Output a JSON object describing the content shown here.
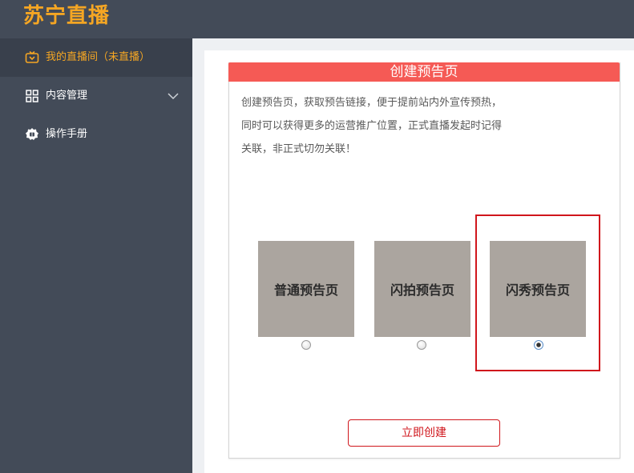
{
  "app": {
    "logo_text": "苏宁直播"
  },
  "sidebar": {
    "items": [
      {
        "label": "我的直播间（未直播）",
        "icon": "tv-icon"
      },
      {
        "label": "内容管理",
        "icon": "grid-icon"
      },
      {
        "label": "操作手册",
        "icon": "manual-icon"
      }
    ]
  },
  "panel": {
    "title": "创建预告页",
    "description": [
      "创建预告页，获取预告链接，便于提前站内外宣传预热，",
      "同时可以获得更多的运营推广位置，正式直播发起时记得",
      "关联，非正式切勿关联！"
    ],
    "options": [
      {
        "label": "普通预告页",
        "selected": false
      },
      {
        "label": "闪拍预告页",
        "selected": false
      },
      {
        "label": "闪秀预告页",
        "selected": true
      }
    ],
    "create_label": "立即创建"
  },
  "colors": {
    "sidebar_bg": "#434b58",
    "accent": "#f5a623",
    "header_red": "#f55a55",
    "brand_red": "#d0161c",
    "card_bg": "#aba59f"
  }
}
